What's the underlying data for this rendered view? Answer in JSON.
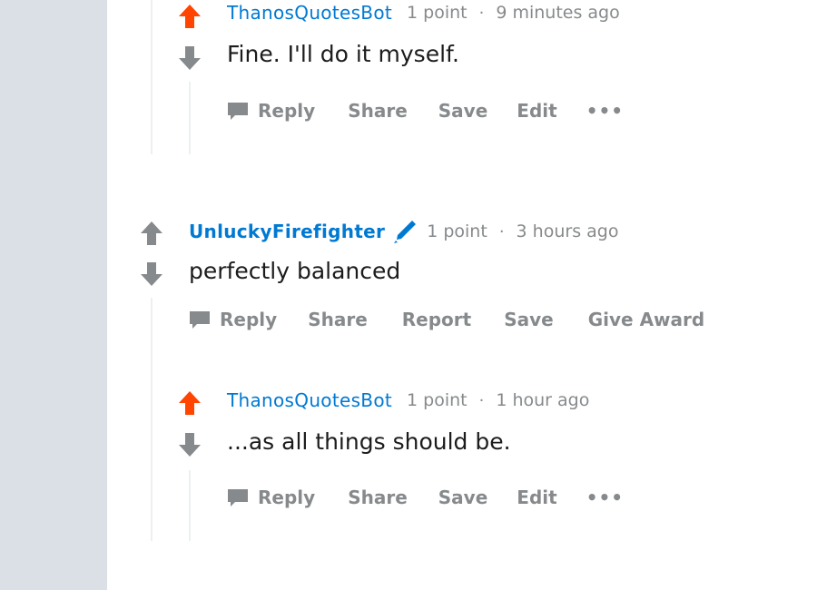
{
  "colors": {
    "accent": "#0079d3",
    "upvoted": "#ff4500",
    "muted": "#878a8c",
    "sidebar": "#dae0e6"
  },
  "comment1": {
    "author": "ThanosQuotesBot",
    "points": "1 point",
    "separator": "·",
    "time": "9 minutes ago",
    "text": "Fine. I'll do it myself.",
    "vote_state": "upvoted",
    "actions": {
      "reply": "Reply",
      "share": "Share",
      "save": "Save",
      "edit": "Edit",
      "more": "•••"
    }
  },
  "comment2": {
    "author": "UnluckyFirefighter",
    "flair_icon": "pencil-icon",
    "points": "1 point",
    "separator": "·",
    "time": "3 hours ago",
    "text": "perfectly balanced",
    "vote_state": "none",
    "actions": {
      "reply": "Reply",
      "share": "Share",
      "report": "Report",
      "save": "Save",
      "give_award": "Give Award"
    }
  },
  "comment3": {
    "author": "ThanosQuotesBot",
    "points": "1 point",
    "separator": "·",
    "time": "1 hour ago",
    "text": "...as all things should be.",
    "vote_state": "upvoted",
    "actions": {
      "reply": "Reply",
      "share": "Share",
      "save": "Save",
      "edit": "Edit",
      "more": "•••"
    }
  }
}
